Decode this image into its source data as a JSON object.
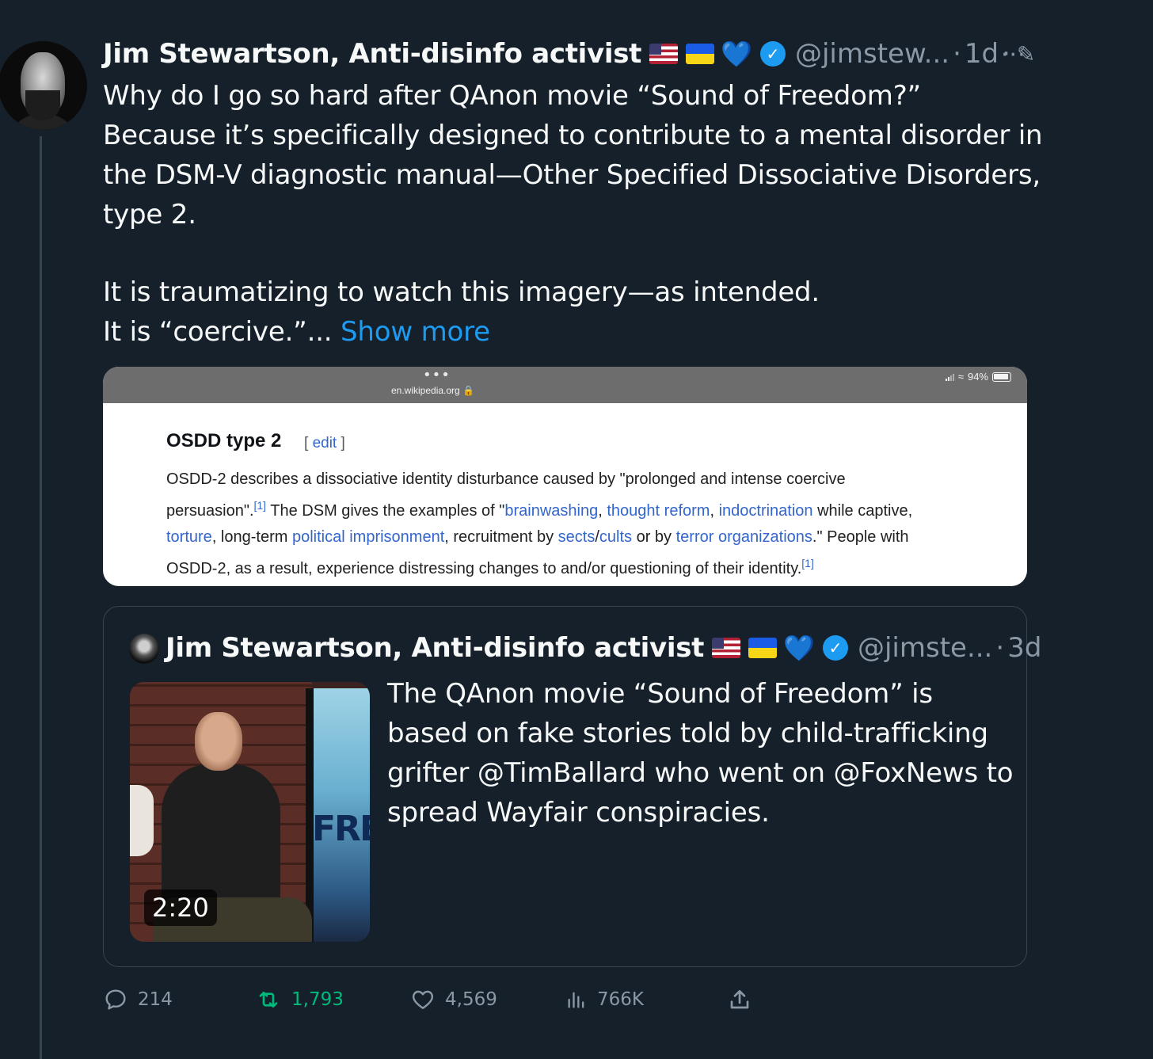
{
  "tweet": {
    "author_name": "Jim Stewartson, Anti-disinfo activist",
    "emoji": {
      "heart": "💙"
    },
    "handle": "@jimstew...",
    "separator": "·",
    "time": "1d",
    "edit_glyph": "✎",
    "more_glyph": "···",
    "text_lines": [
      "Why do I go so hard after QAnon movie “Sound of Freedom?”",
      "Because it’s specifically designed to contribute to a mental disorder in",
      "the DSM-V diagnostic manual—Other Specified Dissociative Disorders,",
      "type 2.",
      "It is traumatizing to watch this imagery—as intended."
    ],
    "last_line_prefix": "It is “coercive.”...",
    "show_more": "Show more"
  },
  "wiki_screenshot": {
    "status_dots": "•••",
    "url": "en.wikipedia.org 🔒",
    "battery": "94%",
    "heading": "OSDD type 2",
    "edit_open": "[ ",
    "edit_label": "edit",
    "edit_close": " ]",
    "ref": "[1]",
    "body": {
      "l1": "OSDD-2 describes a dissociative identity disturbance caused by \"prolonged and intense coercive",
      "l2_a": "persuasion\".",
      "l2_b": " The DSM gives the examples of \"",
      "l2_link1": "brainwashing",
      "comma": ", ",
      "l2_link2": "thought reform",
      "l2_link3": "indoctrination",
      "l2_c": " while captive,",
      "l3_link1": "torture",
      "l3_a": ", long-term ",
      "l3_link2": "political imprisonment",
      "l3_b": ", recruitment by ",
      "l3_link3": "sects",
      "slash": "/",
      "l3_link4": "cults",
      "l3_c": " or by ",
      "l3_link5": "terror organizations",
      "l3_d": ".\" People with",
      "l4": "OSDD-2, as a result, experience distressing changes to and/or questioning of their identity."
    }
  },
  "quoted_tweet": {
    "author_name": "Jim Stewartson, Anti-disinfo activist",
    "handle": "@jimste...",
    "separator": "·",
    "time": "3d",
    "video_duration": "2:20",
    "poster_text": "FREE",
    "text_lines": [
      "The QAnon movie “Sound of Freedom” is",
      "based on fake stories told by child-trafficking",
      "grifter @TimBallard who went on @FoxNews to",
      "spread Wayfair conspiracies."
    ]
  },
  "actions": {
    "replies": "214",
    "retweets": "1,793",
    "likes": "4,569",
    "views": "766K"
  },
  "colors": {
    "background": "#15202b",
    "link_blue": "#1d9bf0",
    "retweet_green": "#00ba7c",
    "muted": "#8b98a5",
    "wiki_link": "#3366cc"
  }
}
